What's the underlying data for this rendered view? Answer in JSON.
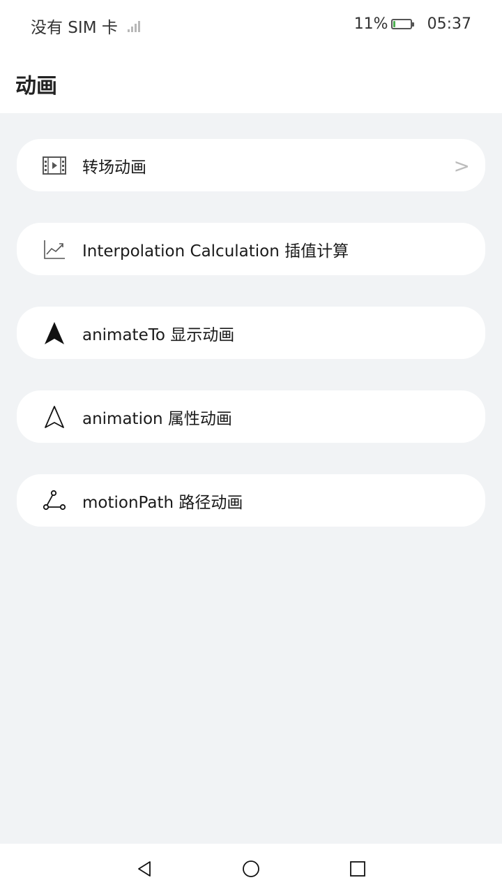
{
  "statusbar": {
    "carrier": "没有 SIM 卡",
    "battery_percent": "11%",
    "battery_level": 0.11,
    "time": "05:37"
  },
  "header": {
    "title": "动画"
  },
  "items": [
    {
      "label": "转场动画",
      "icon": "video-frame-icon"
    },
    {
      "label": "Interpolation Calculation 插值计算",
      "icon": "trend-chart-icon"
    },
    {
      "label": "animateTo 显示动画",
      "icon": "navigation-arrow-filled-icon"
    },
    {
      "label": "animation 属性动画",
      "icon": "navigation-arrow-outline-icon"
    },
    {
      "label": "motionPath 路径动画",
      "icon": "path-nodes-icon"
    }
  ],
  "chevron": ">",
  "colors": {
    "background": "#f1f3f5",
    "card": "#ffffff",
    "text": "#1a1a1a"
  }
}
